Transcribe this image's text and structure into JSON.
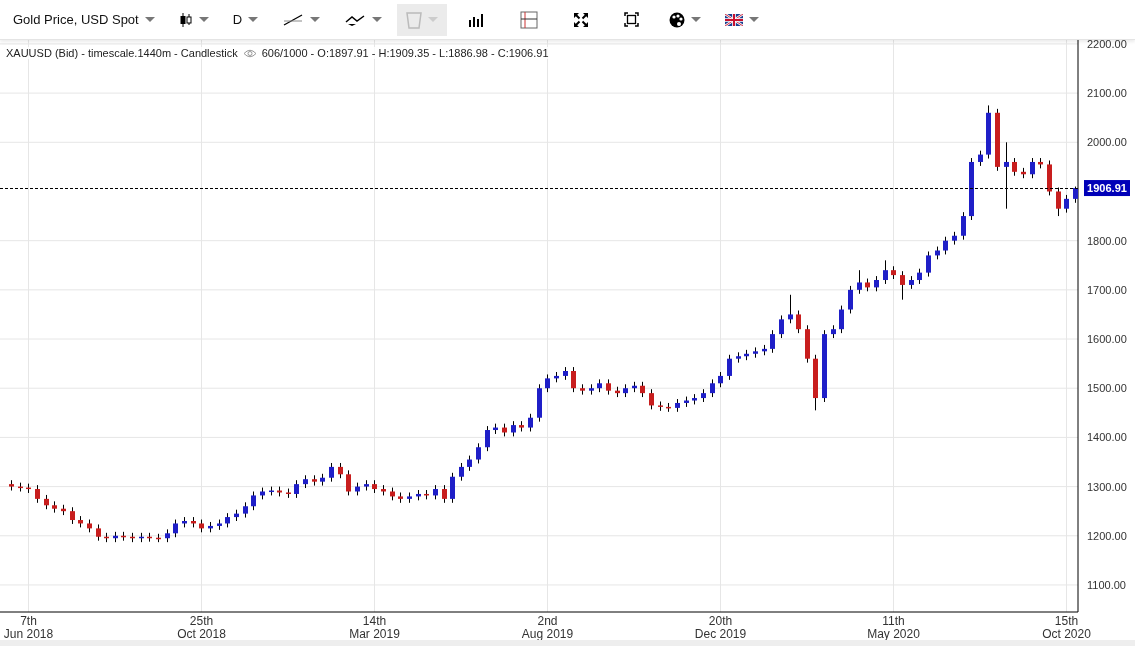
{
  "toolbar": [
    {
      "kind": "text",
      "label": "Gold Price, USD Spot",
      "dropdown": true,
      "disabled": false
    },
    {
      "kind": "candles",
      "dropdown": true,
      "disabled": false
    },
    {
      "kind": "text",
      "label": "D",
      "dropdown": true,
      "disabled": false
    },
    {
      "kind": "line-tool",
      "dropdown": true,
      "disabled": false
    },
    {
      "kind": "draw-tool",
      "dropdown": true,
      "disabled": false
    },
    {
      "kind": "trash",
      "dropdown": true,
      "disabled": true
    },
    {
      "kind": "bars",
      "dropdown": false,
      "disabled": false
    },
    {
      "kind": "crosshair",
      "dropdown": false,
      "disabled": false
    },
    {
      "kind": "expand",
      "dropdown": false,
      "disabled": false
    },
    {
      "kind": "fit",
      "dropdown": false,
      "disabled": false
    },
    {
      "kind": "palette",
      "dropdown": true,
      "disabled": false
    },
    {
      "kind": "flag",
      "dropdown": true,
      "disabled": false
    }
  ],
  "last_price": {
    "label": "1906.91"
  },
  "info": {
    "title": "XAUUSD (Bid) - timescale.1440m - Candlestick",
    "stats": "606/1000 - O:1897.91 - H:1909.35 - L:1886.98 - C:1906.91"
  },
  "chart": {
    "chart_data": {
      "type": "candlestick",
      "grid": true,
      "ylim": [
        1045,
        2208
      ],
      "yticks": [
        {
          "value": 1100,
          "label": "1100.00"
        },
        {
          "value": 1200,
          "label": "1200.00"
        },
        {
          "value": 1300,
          "label": "1300.00"
        },
        {
          "value": 1400,
          "label": "1400.00"
        },
        {
          "value": 1500,
          "label": "1500.00"
        },
        {
          "value": 1600,
          "label": "1600.00"
        },
        {
          "value": 1700,
          "label": "1700.00"
        },
        {
          "value": 1800,
          "label": "1800.00"
        },
        {
          "value": 2000,
          "label": "2000.00"
        },
        {
          "value": 2100,
          "label": "2100.00"
        },
        {
          "value": 2200,
          "label": "2200.00"
        }
      ],
      "categories": [
        null,
        null,
        "7th\nJun 2018",
        null,
        null,
        null,
        null,
        null,
        null,
        null,
        null,
        null,
        null,
        null,
        null,
        null,
        null,
        null,
        null,
        null,
        null,
        null,
        "25th\nOct 2018",
        null,
        null,
        null,
        null,
        null,
        null,
        null,
        null,
        null,
        null,
        null,
        null,
        null,
        null,
        null,
        null,
        null,
        null,
        null,
        "14th\nMar 2019",
        null,
        null,
        null,
        null,
        null,
        null,
        null,
        null,
        null,
        null,
        null,
        null,
        null,
        null,
        null,
        null,
        null,
        null,
        null,
        "2nd\nAug 2019",
        null,
        null,
        null,
        null,
        null,
        null,
        null,
        null,
        null,
        null,
        null,
        null,
        null,
        null,
        null,
        null,
        null,
        null,
        null,
        "20th\nDec 2019",
        null,
        null,
        null,
        null,
        null,
        null,
        null,
        null,
        null,
        null,
        null,
        null,
        null,
        null,
        null,
        null,
        null,
        null,
        null,
        "11th\nMay 2020",
        null,
        null,
        null,
        null,
        null,
        null,
        null,
        null,
        null,
        null,
        null,
        null,
        null,
        null,
        null,
        null,
        null,
        null,
        null,
        "15th\nOct 2020",
        null
      ],
      "ohlc": [
        [
          1305,
          1313,
          1292,
          1300
        ],
        [
          1300,
          1308,
          1290,
          1298
        ],
        [
          1298,
          1306,
          1287,
          1295
        ],
        [
          1295,
          1303,
          1267,
          1275
        ],
        [
          1275,
          1283,
          1254,
          1262
        ],
        [
          1262,
          1270,
          1247,
          1255
        ],
        [
          1255,
          1263,
          1242,
          1250
        ],
        [
          1250,
          1258,
          1224,
          1232
        ],
        [
          1232,
          1240,
          1217,
          1225
        ],
        [
          1225,
          1233,
          1207,
          1215
        ],
        [
          1215,
          1223,
          1190,
          1198
        ],
        [
          1198,
          1206,
          1187,
          1195
        ],
        [
          1195,
          1208,
          1187,
          1200
        ],
        [
          1200,
          1208,
          1190,
          1198
        ],
        [
          1198,
          1206,
          1187,
          1195
        ],
        [
          1195,
          1206,
          1187,
          1198
        ],
        [
          1198,
          1206,
          1188,
          1196
        ],
        [
          1196,
          1204,
          1187,
          1195
        ],
        [
          1195,
          1213,
          1187,
          1205
        ],
        [
          1205,
          1233,
          1197,
          1225
        ],
        [
          1225,
          1238,
          1217,
          1230
        ],
        [
          1230,
          1238,
          1217,
          1225
        ],
        [
          1225,
          1233,
          1207,
          1215
        ],
        [
          1215,
          1228,
          1207,
          1220
        ],
        [
          1220,
          1233,
          1212,
          1225
        ],
        [
          1225,
          1246,
          1217,
          1238
        ],
        [
          1238,
          1253,
          1230,
          1245
        ],
        [
          1245,
          1268,
          1237,
          1260
        ],
        [
          1260,
          1290,
          1252,
          1282
        ],
        [
          1282,
          1298,
          1274,
          1290
        ],
        [
          1290,
          1300,
          1282,
          1292
        ],
        [
          1292,
          1300,
          1280,
          1288
        ],
        [
          1288,
          1296,
          1277,
          1285
        ],
        [
          1285,
          1313,
          1277,
          1305
        ],
        [
          1305,
          1323,
          1297,
          1315
        ],
        [
          1315,
          1323,
          1302,
          1310
        ],
        [
          1310,
          1326,
          1302,
          1318
        ],
        [
          1318,
          1348,
          1310,
          1340
        ],
        [
          1340,
          1348,
          1317,
          1325
        ],
        [
          1325,
          1333,
          1282,
          1290
        ],
        [
          1290,
          1308,
          1282,
          1300
        ],
        [
          1300,
          1313,
          1292,
          1305
        ],
        [
          1305,
          1313,
          1287,
          1295
        ],
        [
          1295,
          1303,
          1282,
          1290
        ],
        [
          1290,
          1298,
          1272,
          1280
        ],
        [
          1280,
          1288,
          1267,
          1275
        ],
        [
          1275,
          1288,
          1267,
          1280
        ],
        [
          1280,
          1293,
          1272,
          1285
        ],
        [
          1285,
          1293,
          1274,
          1282
        ],
        [
          1282,
          1303,
          1274,
          1295
        ],
        [
          1295,
          1303,
          1267,
          1275
        ],
        [
          1275,
          1328,
          1267,
          1320
        ],
        [
          1320,
          1348,
          1312,
          1340
        ],
        [
          1340,
          1363,
          1332,
          1355
        ],
        [
          1355,
          1388,
          1347,
          1380
        ],
        [
          1380,
          1423,
          1372,
          1415
        ],
        [
          1415,
          1428,
          1407,
          1420
        ],
        [
          1420,
          1428,
          1402,
          1410
        ],
        [
          1410,
          1433,
          1402,
          1425
        ],
        [
          1425,
          1433,
          1412,
          1420
        ],
        [
          1420,
          1448,
          1412,
          1440
        ],
        [
          1440,
          1508,
          1432,
          1500
        ],
        [
          1500,
          1528,
          1492,
          1520
        ],
        [
          1520,
          1533,
          1512,
          1525
        ],
        [
          1525,
          1543,
          1517,
          1535
        ],
        [
          1535,
          1543,
          1492,
          1500
        ],
        [
          1500,
          1508,
          1487,
          1495
        ],
        [
          1495,
          1508,
          1487,
          1500
        ],
        [
          1500,
          1518,
          1492,
          1510
        ],
        [
          1510,
          1518,
          1487,
          1495
        ],
        [
          1495,
          1503,
          1482,
          1490
        ],
        [
          1490,
          1508,
          1482,
          1500
        ],
        [
          1500,
          1513,
          1492,
          1505
        ],
        [
          1505,
          1513,
          1482,
          1490
        ],
        [
          1490,
          1498,
          1457,
          1465
        ],
        [
          1465,
          1473,
          1454,
          1462
        ],
        [
          1462,
          1470,
          1452,
          1460
        ],
        [
          1460,
          1478,
          1452,
          1470
        ],
        [
          1470,
          1483,
          1462,
          1475
        ],
        [
          1475,
          1488,
          1467,
          1480
        ],
        [
          1480,
          1498,
          1472,
          1490
        ],
        [
          1490,
          1518,
          1482,
          1510
        ],
        [
          1510,
          1533,
          1502,
          1525
        ],
        [
          1525,
          1568,
          1517,
          1560
        ],
        [
          1560,
          1573,
          1552,
          1565
        ],
        [
          1565,
          1578,
          1557,
          1570
        ],
        [
          1570,
          1583,
          1562,
          1575
        ],
        [
          1575,
          1588,
          1567,
          1580
        ],
        [
          1580,
          1618,
          1572,
          1610
        ],
        [
          1610,
          1648,
          1602,
          1640
        ],
        [
          1640,
          1690,
          1632,
          1650
        ],
        [
          1650,
          1658,
          1612,
          1620
        ],
        [
          1620,
          1628,
          1552,
          1560
        ],
        [
          1560,
          1568,
          1455,
          1480
        ],
        [
          1480,
          1618,
          1472,
          1610
        ],
        [
          1610,
          1628,
          1602,
          1620
        ],
        [
          1620,
          1668,
          1612,
          1660
        ],
        [
          1660,
          1708,
          1652,
          1700
        ],
        [
          1700,
          1740,
          1692,
          1715
        ],
        [
          1715,
          1723,
          1697,
          1705
        ],
        [
          1705,
          1728,
          1697,
          1720
        ],
        [
          1720,
          1760,
          1712,
          1740
        ],
        [
          1740,
          1748,
          1722,
          1730
        ],
        [
          1730,
          1738,
          1680,
          1710
        ],
        [
          1710,
          1728,
          1702,
          1720
        ],
        [
          1720,
          1743,
          1712,
          1735
        ],
        [
          1735,
          1778,
          1727,
          1770
        ],
        [
          1770,
          1788,
          1762,
          1780
        ],
        [
          1780,
          1808,
          1772,
          1800
        ],
        [
          1800,
          1818,
          1792,
          1810
        ],
        [
          1810,
          1858,
          1802,
          1850
        ],
        [
          1850,
          1968,
          1842,
          1960
        ],
        [
          1960,
          1983,
          1952,
          1975
        ],
        [
          1975,
          2075,
          1967,
          2060
        ],
        [
          2060,
          2068,
          1942,
          1950
        ],
        [
          1950,
          2000,
          1865,
          1960
        ],
        [
          1960,
          1968,
          1932,
          1940
        ],
        [
          1940,
          1948,
          1927,
          1935
        ],
        [
          1935,
          1968,
          1927,
          1960
        ],
        [
          1960,
          1968,
          1947,
          1955
        ],
        [
          1955,
          1963,
          1892,
          1900
        ],
        [
          1900,
          1908,
          1850,
          1865
        ],
        [
          1865,
          1893,
          1857,
          1885
        ],
        [
          1885,
          1910,
          1877,
          1907
        ]
      ]
    }
  }
}
